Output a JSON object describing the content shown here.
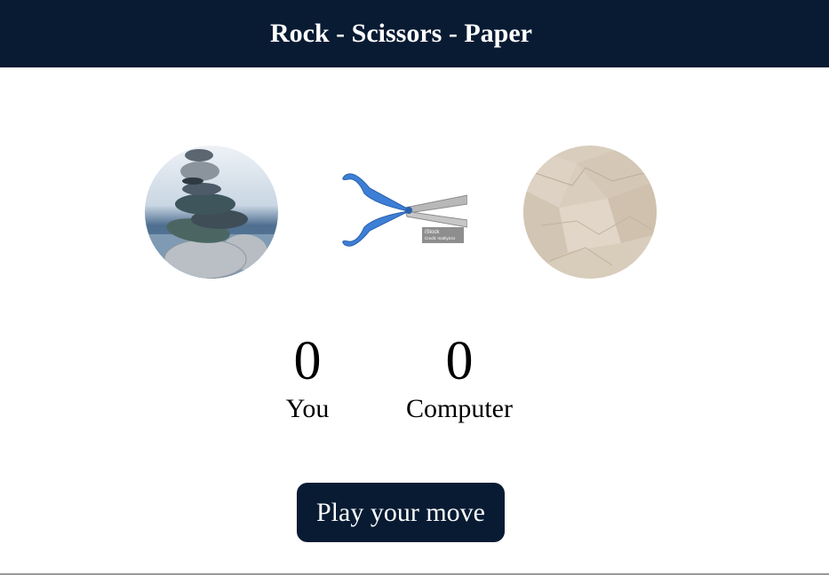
{
  "header": {
    "title": "Rock - Scissors - Paper"
  },
  "choices": [
    {
      "id": "rock",
      "icon": "rock-stack-image"
    },
    {
      "id": "scissors",
      "icon": "scissors-image",
      "watermark": "iStock",
      "credit": "Credit: mathy244"
    },
    {
      "id": "paper",
      "icon": "crumpled-paper-image"
    }
  ],
  "scores": {
    "user": {
      "value": "0",
      "label": "You"
    },
    "computer": {
      "value": "0",
      "label": "Computer"
    }
  },
  "play_button": {
    "label": "Play your move"
  },
  "colors": {
    "navy": "#081b33",
    "scissors_blue": "#3d7fd6",
    "paper": "#d9cdbd"
  }
}
